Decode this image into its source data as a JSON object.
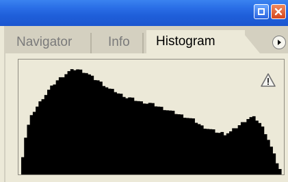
{
  "window": {
    "buttons": {
      "minimize_icon": "minimize-icon",
      "close_icon": "close-icon"
    }
  },
  "tabs": [
    {
      "label": "Navigator",
      "active": false
    },
    {
      "label": "Info",
      "active": false
    },
    {
      "label": "Histogram",
      "active": true
    }
  ],
  "panel_menu_icon": "panel-menu-arrow-icon",
  "histogram": {
    "warning_icon": "warning-icon",
    "fill_color": "#000000",
    "background_color": "#ece9d8",
    "levels": [
      0.17,
      0.34,
      0.45,
      0.53,
      0.58,
      0.62,
      0.66,
      0.7,
      0.73,
      0.77,
      0.8,
      0.83,
      0.86,
      0.88,
      0.9,
      0.92,
      0.94,
      0.95,
      0.96,
      0.96,
      0.95,
      0.94,
      0.93,
      0.91,
      0.89,
      0.87,
      0.86,
      0.84,
      0.82,
      0.8,
      0.78,
      0.77,
      0.76,
      0.74,
      0.73,
      0.72,
      0.7,
      0.7,
      0.69,
      0.68,
      0.67,
      0.66,
      0.66,
      0.65,
      0.65,
      0.64,
      0.63,
      0.62,
      0.61,
      0.6,
      0.59,
      0.58,
      0.57,
      0.56,
      0.55,
      0.54,
      0.53,
      0.52,
      0.51,
      0.5,
      0.48,
      0.46,
      0.44,
      0.43,
      0.42,
      0.41,
      0.4,
      0.39,
      0.38,
      0.38,
      0.37,
      0.38,
      0.39,
      0.41,
      0.43,
      0.45,
      0.47,
      0.49,
      0.51,
      0.52,
      0.52,
      0.5,
      0.47,
      0.43,
      0.38,
      0.32,
      0.25,
      0.18,
      0.11,
      0.05
    ]
  }
}
